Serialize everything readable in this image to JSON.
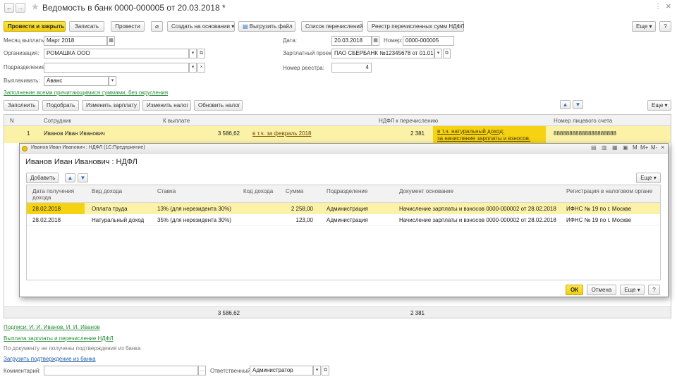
{
  "window": {
    "title": "Ведомость в банк 0000-000005 от 20.03.2018 *",
    "close_glyph": "×",
    "more_glyph": "⋮"
  },
  "toolbar": {
    "post_close": "Провести и закрыть",
    "save": "Записать",
    "post": "Провести",
    "create_based": "Создать на основании",
    "export_file": "Выгрузить файл",
    "transfers_list": "Список перечислений",
    "ndfl_registry": "Реестр перечисленных сумм НДФЛ",
    "more": "Еще"
  },
  "form": {
    "pay_month_label": "Месяц выплаты:",
    "pay_month_value": "Март 2018",
    "org_label": "Организация:",
    "org_value": "РОМАШКА ООО",
    "dept_label": "Подразделение:",
    "dept_value": "",
    "pay_label": "Выплачивать:",
    "pay_value": "Аванс",
    "date_label": "Дата:",
    "date_value": "20.03.2018",
    "number_label": "Номер:",
    "number_value": "0000-000005",
    "salary_project_label": "Зарплатный проект:",
    "salary_project_value": "ПАО СБЕРБАНК №12345678 от 01.01.2018",
    "registry_number_label": "Номер реестра:",
    "registry_number_value": "4",
    "fill_link": "Заполнение всеми причитающимися суммами, без округления"
  },
  "table_toolbar": {
    "fill": "Заполнить",
    "select": "Подобрать",
    "change_salary": "Изменить зарплату",
    "change_tax": "Изменить налог",
    "update_tax": "Обновить налог",
    "more": "Еще"
  },
  "main_table": {
    "headers": [
      "N",
      "Сотрудник",
      "К выплате",
      "НДФЛ к перечислению",
      "Номер лицевого счета"
    ],
    "row": {
      "n": "1",
      "employee": "Иванов Иван Иванович",
      "amount": "3 586,62",
      "amount_note": "в т.ч. за февраль 2018",
      "ndfl": "2 381",
      "ndfl_note_1": "в т.ч. натуральный доход:",
      "ndfl_note_2": "за начисление зарплаты и взносов.",
      "account": "88888888888888888888"
    },
    "footer_amount": "3 586,62",
    "footer_ndfl": "2 381"
  },
  "dialog": {
    "caption": "Иванов Иван Иванович : НДФЛ (1С:Предприятие)",
    "title": "Иванов Иван Иванович : НДФЛ",
    "add": "Добавить",
    "more": "Еще",
    "ok": "ОК",
    "cancel": "Отмена",
    "help": "?",
    "tool_m": "M",
    "tool_mplus": "M+",
    "tool_mminus": "M-",
    "headers": [
      "Дата получения",
      "дохода",
      "Вид дохода",
      "Ставка",
      "Код дохода",
      "Сумма",
      "Подразделение",
      "Документ основание",
      "Регистрация в налоговом органе"
    ],
    "rows": [
      {
        "date": "28.02.2018",
        "type": "Оплата труда",
        "rate": "13% (для нерезидента 30%)",
        "code": "",
        "sum": "2 258,00",
        "dept": "Администрация",
        "doc": "Начисление зарплаты и взносов 0000-000002 от 28.02.2018",
        "reg": "ИФНС № 19 по г. Москве"
      },
      {
        "date": "28.02.2018",
        "type": "Натуральный доход",
        "rate": "35% (для нерезидента 30%)",
        "code": "",
        "sum": "123,00",
        "dept": "Администрация",
        "doc": "Начисление зарплаты и взносов 0000-000002 от 28.02.2018",
        "reg": "ИФНС № 19 по г. Москве"
      }
    ]
  },
  "bottom": {
    "signatures_link": "Подписи: И. И. Иванов, И. И. Иванов",
    "payment_link": "Выплата зарплаты и перечисление НДФЛ",
    "no_confirm": "По документу не получены подтверждения из банка",
    "load_confirm_link": "Загрузить подтверждение из банка",
    "comment_label": "Комментарий:",
    "comment_value": "",
    "responsible_label": "Ответственный:",
    "responsible_value": "Администратор"
  }
}
